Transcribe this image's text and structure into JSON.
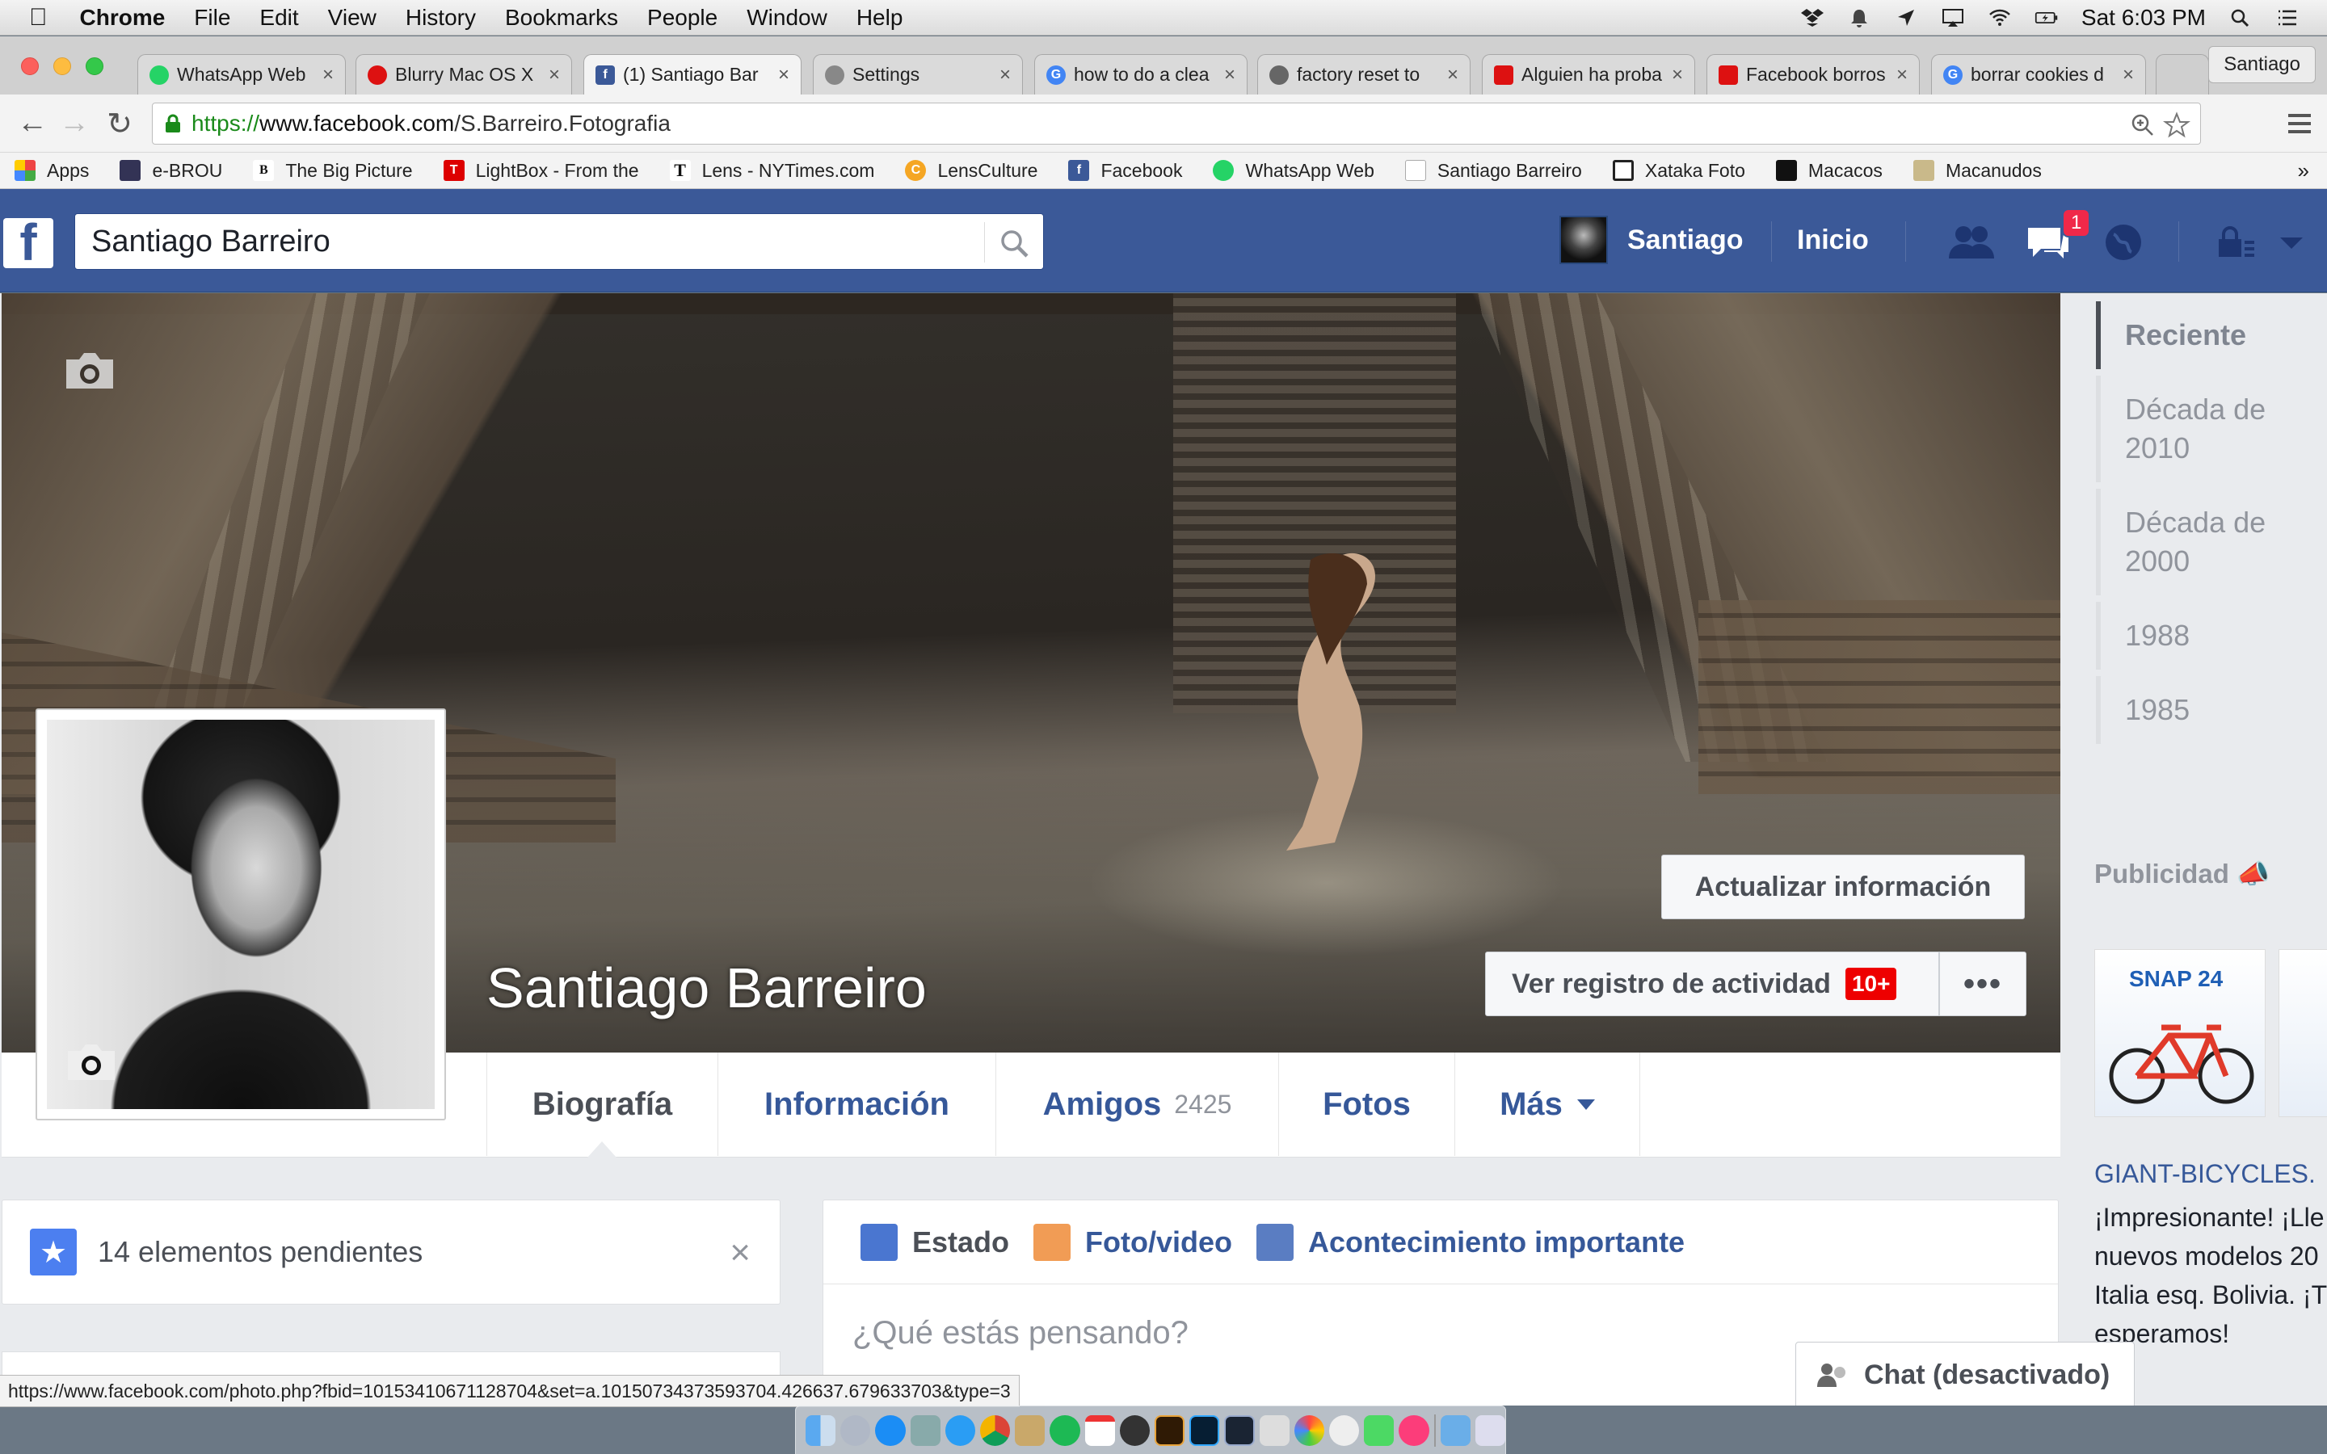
{
  "menubar": {
    "app": "Chrome",
    "items": [
      "File",
      "Edit",
      "View",
      "History",
      "Bookmarks",
      "People",
      "Window",
      "Help"
    ],
    "clock": "Sat 6:03 PM"
  },
  "tabs": [
    {
      "title": "WhatsApp Web",
      "color": "#25d366"
    },
    {
      "title": "Blurry Mac OS X",
      "color": "#d11"
    },
    {
      "title": "(1) Santiago Bar",
      "color": "#3b5998"
    },
    {
      "title": "Settings",
      "color": "#777"
    },
    {
      "title": "how to do a clea",
      "color": "#4285f4"
    },
    {
      "title": "factory reset to",
      "color": "#555"
    },
    {
      "title": "Alguien ha proba",
      "color": "#d11"
    },
    {
      "title": "Facebook borros",
      "color": "#d11"
    },
    {
      "title": "borrar cookies d",
      "color": "#4285f4"
    }
  ],
  "profile_button": "Santiago",
  "address": {
    "scheme": "https://",
    "host": "www.facebook.com",
    "path": "/S.Barreiro.Fotografia"
  },
  "bookmarks": [
    {
      "label": "Apps",
      "color": "#e44"
    },
    {
      "label": "e-BROU",
      "color": "#335"
    },
    {
      "label": "The Big Picture",
      "color": "#333"
    },
    {
      "label": "LightBox - From the",
      "color": "#d00"
    },
    {
      "label": "Lens - NYTimes.com",
      "color": "#111"
    },
    {
      "label": "LensCulture",
      "color": "#f5a623"
    },
    {
      "label": "Facebook",
      "color": "#3b5998"
    },
    {
      "label": "WhatsApp Web",
      "color": "#25d366"
    },
    {
      "label": "Santiago Barreiro",
      "color": "#ddd"
    },
    {
      "label": "Xataka Foto",
      "color": "#222"
    },
    {
      "label": "Macacos",
      "color": "#111"
    },
    {
      "label": "Macanudos",
      "color": "#7a5"
    }
  ],
  "fb": {
    "search_value": "Santiago Barreiro",
    "user": "Santiago",
    "home": "Inicio",
    "notif_count": "1"
  },
  "profile": {
    "name": "Santiago Barreiro",
    "update_btn": "Actualizar información",
    "activity_btn": "Ver registro de actividad",
    "activity_badge": "10+",
    "more_btn": "•••"
  },
  "nav": {
    "biografia": "Biografía",
    "informacion": "Información",
    "amigos": "Amigos",
    "amigos_count": "2425",
    "fotos": "Fotos",
    "mas": "Más"
  },
  "pending": {
    "text": "14 elementos pendientes",
    "close": "×"
  },
  "composer": {
    "tab_estado": "Estado",
    "tab_foto": "Foto/video",
    "tab_acontecimiento": "Acontecimiento importante",
    "placeholder": "¿Qué estás pensando?"
  },
  "timeline": [
    {
      "label": "Reciente"
    },
    {
      "label": "Década de 2010"
    },
    {
      "label": "Década de 2000"
    },
    {
      "label": "1988"
    },
    {
      "label": "1985"
    }
  ],
  "ads": {
    "heading": "Publicidad",
    "product_label": "SNAP 24",
    "title": "GIANT-BICYCLES.",
    "body": "¡Impresionante! ¡Lle nuevos modelos 20 Italia esq. Bolivia. ¡T esperamos!"
  },
  "chat": "Chat (desactivado)",
  "status_url": "https://www.facebook.com/photo.php?fbid=10153410671128704&set=a.10150734373593704.426637.679633703&type=3",
  "colors": {
    "fb_blue": "#3b5998",
    "link": "#365899",
    "badge": "#f02849"
  }
}
